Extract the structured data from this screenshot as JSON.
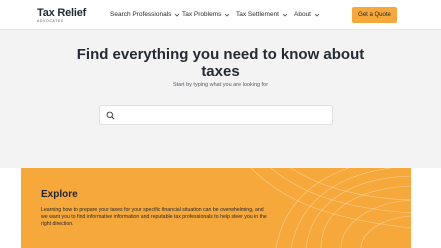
{
  "header": {
    "logo_main": "Tax Relief",
    "logo_sub": "ADVOCATES",
    "nav": [
      {
        "label": "Search Professionals"
      },
      {
        "label": "Tax Problems"
      },
      {
        "label": "Tax Settlement"
      },
      {
        "label": "About"
      }
    ],
    "cta_label": "Get a Quote"
  },
  "hero": {
    "title": "Find everything you need to know about taxes",
    "subtitle": "Start by typing what you are looking for",
    "search_placeholder": ""
  },
  "explore": {
    "title": "Explore",
    "body": "Learning how to prepare your taxes for your specific financial situation can be overwhelming, and we want you to find informative information and reputable tax professionals to help steer you in the right direction."
  },
  "colors": {
    "accent": "#f6a83a",
    "hero_bg": "#f3f3f3",
    "text_dark": "#1f2430"
  }
}
